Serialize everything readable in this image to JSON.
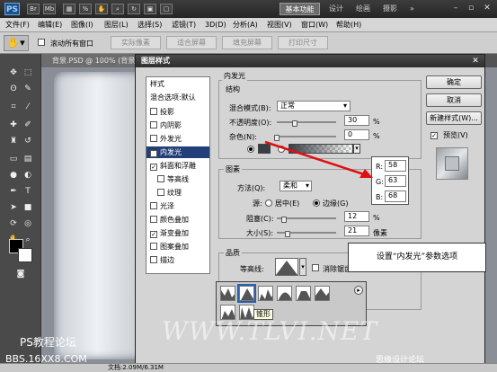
{
  "titlebar": {
    "logo": "PS",
    "workspaces": {
      "active": "基本功能",
      "tabs": [
        "设计",
        "绘画",
        "摄影"
      ],
      "more": "»"
    }
  },
  "menubar": [
    "文件(F)",
    "编辑(E)",
    "图像(I)",
    "图层(L)",
    "选择(S)",
    "滤镜(T)",
    "3D(D)",
    "分析(A)",
    "视图(V)",
    "窗口(W)",
    "帮助(H)"
  ],
  "optionsbar": {
    "scroll_all": "滚动所有窗口",
    "buttons": [
      "实际像素",
      "适合屏幕",
      "填充屏幕",
      "打印尺寸"
    ]
  },
  "document": {
    "tab": "背景.PSD @ 100% (背景"
  },
  "dialog": {
    "title": "图层样式",
    "styles_header": "样式",
    "blend_options": "混合选项:默认",
    "styles": [
      {
        "label": "投影",
        "checked": false,
        "indent": false
      },
      {
        "label": "内阴影",
        "checked": false,
        "indent": false
      },
      {
        "label": "外发光",
        "checked": false,
        "indent": false
      },
      {
        "label": "内发光",
        "checked": true,
        "indent": false,
        "selected": true
      },
      {
        "label": "斜面和浮雕",
        "checked": true,
        "indent": false
      },
      {
        "label": "等高线",
        "checked": false,
        "indent": true
      },
      {
        "label": "纹理",
        "checked": false,
        "indent": true
      },
      {
        "label": "光泽",
        "checked": false,
        "indent": false
      },
      {
        "label": "颜色叠加",
        "checked": false,
        "indent": false
      },
      {
        "label": "渐变叠加",
        "checked": true,
        "indent": false
      },
      {
        "label": "图案叠加",
        "checked": false,
        "indent": false
      },
      {
        "label": "描边",
        "checked": false,
        "indent": false
      }
    ],
    "panel": {
      "section": "内发光",
      "structure": {
        "label": "结构",
        "blend_mode_label": "混合模式(B):",
        "blend_mode": "正常",
        "opacity_label": "不透明度(O):",
        "opacity": "30",
        "noise_label": "杂色(N):",
        "noise": "0",
        "percent": "%"
      },
      "elements": {
        "label": "图素",
        "method_label": "方法(Q):",
        "method": "柔和",
        "source_label": "源:",
        "center": "居中(E)",
        "edge": "边缘(G)",
        "choke_label": "阻塞(C):",
        "choke": "12",
        "size_label": "大小(S):",
        "size": "21",
        "px": "像素"
      },
      "quality": {
        "label": "品质",
        "contour_label": "等高线:",
        "antialias": "消除锯齿"
      }
    },
    "buttons": {
      "ok": "确定",
      "cancel": "取消",
      "new_style": "新建样式(W)...",
      "preview": "预览(V)"
    },
    "rgb": {
      "r_label": "R:",
      "r": "58",
      "g_label": "G:",
      "g": "63",
      "b_label": "B:",
      "b": "68"
    },
    "glow_color": "#3a3f44"
  },
  "callout": "设置“内发光”参数选项",
  "contour_tooltip": "锥形",
  "watermarks": {
    "forum": "PS教程论坛",
    "forum_url": "BBS.16XX8.COM",
    "site": "WWW.TLVI.NET",
    "site2": "思缘设计论坛"
  },
  "statusbar": {
    "doc": "文档:2.09M/6.31M"
  }
}
